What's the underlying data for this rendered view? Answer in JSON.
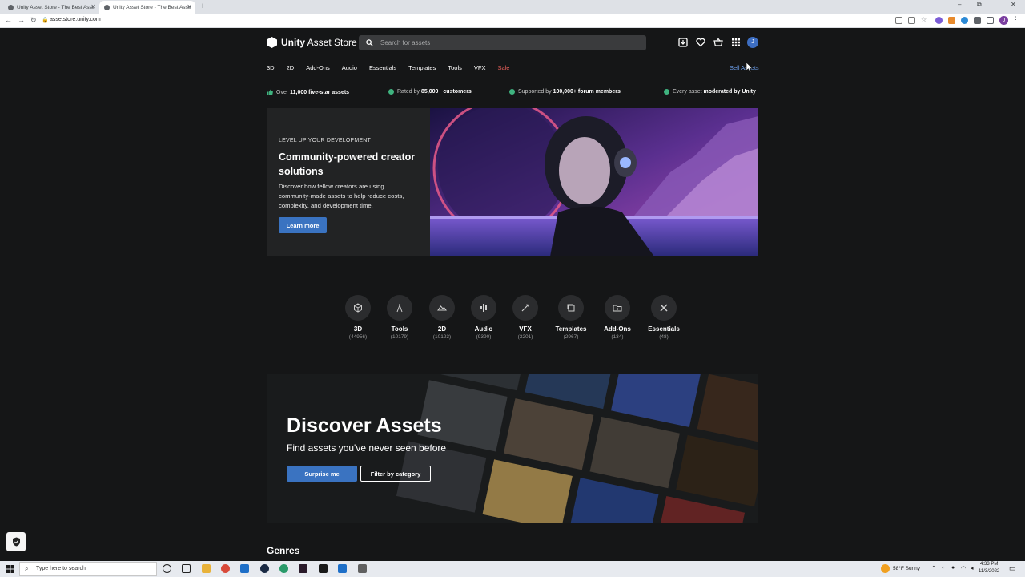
{
  "browser": {
    "tabs": [
      {
        "title": "Unity Asset Store - The Best Asse"
      },
      {
        "title": "Unity Asset Store - The Best Asse"
      }
    ],
    "new_tab": "+",
    "url": "assetstore.unity.com",
    "profile_initial": "J",
    "window_controls": {
      "minimize": "–",
      "restore": "⧉",
      "close": "✕"
    }
  },
  "header": {
    "logo_bold": "Unity",
    "logo_text": "Asset Store",
    "search_placeholder": "Search for assets",
    "avatar_initial": "J"
  },
  "nav": {
    "categories": [
      "3D",
      "2D",
      "Add-Ons",
      "Audio",
      "Essentials",
      "Templates",
      "Tools",
      "VFX",
      "Sale"
    ],
    "sell_link": "Sell Assets"
  },
  "trust_bar": [
    {
      "pre": "Over ",
      "bold": "11,000 five-star assets",
      "post": ""
    },
    {
      "pre": "Rated by ",
      "bold": "85,000+ customers",
      "post": ""
    },
    {
      "pre": "Supported by ",
      "bold": "100,000+ forum members",
      "post": ""
    },
    {
      "pre": "Every asset ",
      "bold": "moderated by Unity",
      "post": ""
    }
  ],
  "hero": {
    "eyebrow": "LEVEL UP YOUR DEVELOPMENT",
    "title": "Community-powered creator solutions",
    "body": "Discover how fellow creators are using community-made assets to help reduce costs, complexity, and development time.",
    "cta": "Learn more"
  },
  "category_cards": [
    {
      "label": "3D",
      "count": "(44956)",
      "icon": "cube-icon"
    },
    {
      "label": "Tools",
      "count": "(10179)",
      "icon": "compass-icon"
    },
    {
      "label": "2D",
      "count": "(10123)",
      "icon": "mountain-icon"
    },
    {
      "label": "Audio",
      "count": "(9390)",
      "icon": "audio-icon"
    },
    {
      "label": "VFX",
      "count": "(3201)",
      "icon": "wand-icon"
    },
    {
      "label": "Templates",
      "count": "(2967)",
      "icon": "template-icon"
    },
    {
      "label": "Add-Ons",
      "count": "(134)",
      "icon": "folder-plus-icon"
    },
    {
      "label": "Essentials",
      "count": "(48)",
      "icon": "tools-icon"
    }
  ],
  "discover": {
    "title": "Discover Assets",
    "subtitle": "Find assets you've never seen before",
    "primary_cta": "Surprise me",
    "secondary_cta": "Filter by category"
  },
  "genres_heading": "Genres",
  "taskbar": {
    "search_placeholder": "Type here to search",
    "weather": "58°F  Sunny",
    "time": "4:33 PM",
    "date": "11/3/2022"
  },
  "colors": {
    "page_bg": "#151617",
    "accent_blue": "#3a73c1",
    "sale_red": "#e8605a",
    "link_blue": "#6da1f0",
    "check_green": "#3fb37f"
  }
}
